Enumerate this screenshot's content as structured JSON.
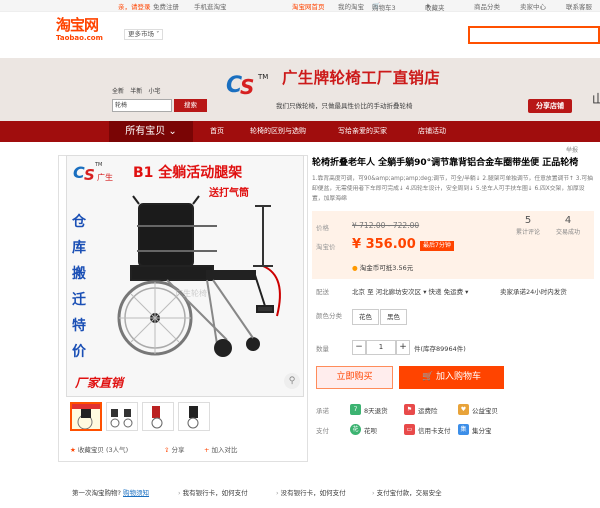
{
  "topbar": {
    "welcome": "亲，请登录",
    "register": "免费注册",
    "mobile": "手机逛淘宝",
    "home": "淘宝网首页",
    "my_taobao": "我的淘宝",
    "cart": "购物车3",
    "favorites": "收藏夹",
    "categories": "商品分类",
    "seller_center": "卖家中心",
    "service": "联系客服"
  },
  "header": {
    "logo_cn": "淘宝网",
    "logo_en": "Taobao.com",
    "market": "更多市场"
  },
  "banner": {
    "shop_name": "广生牌轮椅工厂直销店",
    "slogan": "我们只做轮椅，只做最具性价比的手动折叠轮椅",
    "share_button": "分享店铺",
    "corner_char": "山",
    "search_filters": [
      "全新",
      "半新",
      "小宅"
    ],
    "search_value": "轮椅",
    "search_button": "搜索"
  },
  "nav": {
    "all_items": "所有宝贝",
    "items": [
      "首页",
      "轮椅的区别与选购",
      "写给亲爱的买家",
      "店铺活动"
    ]
  },
  "product": {
    "cam_label": "举报",
    "title": "轮椅折叠老年人 全躺手躺90°调节靠背铝合金车圈带坐便 正品轮椅",
    "subtitle": "1.靠背高度可调，可90&amp;amp;amp;deg;调节，可全/半躺↓ 2.腿架可单独调节，任意放置调节↑ 3.可抽卸便盆，无需使用者下车即可完成↓ 4.四轮车设计，安全周到↓ 5.坐车人可手扶车圈↓ 6.四X交架，加厚设置，加厚海绵",
    "image_headline": "B1 全躺活动腿架",
    "image_brand": "广生",
    "image_pump": "送打气筒",
    "image_side_text": [
      "仓",
      "库",
      "搬",
      "迁",
      "特",
      "价"
    ],
    "image_bottom": "厂家直销",
    "image_watermark": "广生轮椅",
    "price_label": "价格",
    "original_price": "¥ 712.00 - 722.00",
    "promo_label": "淘宝价",
    "promo_price": "¥ 356.00",
    "promo_tag": "最后7分钟",
    "coin_text": "淘金币可抵3.56元",
    "stats": [
      {
        "value": "5",
        "label": "累计评论"
      },
      {
        "value": "4",
        "label": "交易成功"
      }
    ],
    "shipping_label": "配送",
    "shipping_value": "北京 至 河北廊坊安次区 ▾  快递 免运费 ▾",
    "shipping_note": "卖家承诺24小时内发货",
    "color_label": "颜色分类",
    "colors": [
      "花色",
      "黑色"
    ],
    "qty_label": "数量",
    "qty_value": "1",
    "stock": "件(库存89964件)",
    "buy_now": "立即购买",
    "add_to_cart": "加入购物车",
    "promise_label": "承诺",
    "promises": [
      "8天退货",
      "运费险",
      "公益宝贝"
    ],
    "pay_label": "支付",
    "payments": [
      "花呗",
      "信用卡支付",
      "集分宝"
    ],
    "favorite": "收藏宝贝 (3人气)",
    "share": "分享",
    "compare": "加入对比"
  },
  "footer": {
    "first_time": "第一次淘宝购物?",
    "guide_link": "购物须知",
    "has_card": "我有银行卡，如何支付",
    "no_card": "没有银行卡，如何支付",
    "alipay": "支付宝付款，交易安全"
  },
  "colors": {
    "taobao_orange": "#ff4400",
    "shop_red": "#a00d0d",
    "price_bg": "#fff2e8"
  }
}
